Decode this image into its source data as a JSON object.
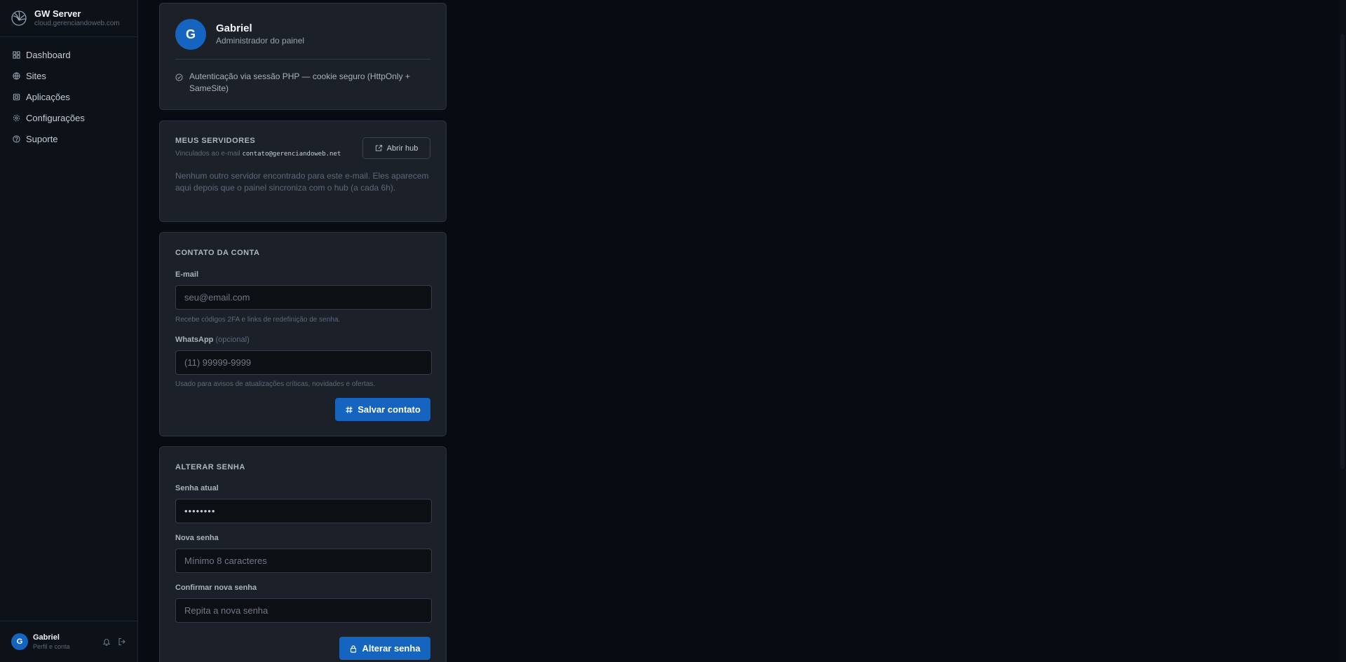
{
  "brand": {
    "name": "GW Server",
    "domain": "cloud.gerenciandoweb.com"
  },
  "nav": [
    {
      "label": "Dashboard",
      "icon": "grid-icon"
    },
    {
      "label": "Sites",
      "icon": "globe-icon"
    },
    {
      "label": "Aplicações",
      "icon": "box-icon"
    },
    {
      "label": "Configurações",
      "icon": "gear-icon"
    },
    {
      "label": "Suporte",
      "icon": "help-circle-icon"
    }
  ],
  "user": {
    "initial": "G",
    "name": "Gabriel",
    "subtitle": "Perfil e conta"
  },
  "profile": {
    "initial": "G",
    "name": "Gabriel",
    "role": "Administrador do painel",
    "auth_note": "Autenticação via sessão PHP — cookie seguro (HttpOnly + SameSite)"
  },
  "servers": {
    "title": "MEUS SERVIDORES",
    "subtitle_prefix": "Vinculados ao e-mail",
    "email": "contato@gerenciandoweb.net",
    "hub_button": "Abrir hub",
    "empty_text": "Nenhum outro servidor encontrado para este e-mail. Eles aparecem aqui depois que o painel sincroniza com o hub (a cada 6h)."
  },
  "contact": {
    "title": "CONTATO DA CONTA",
    "email_label": "E-mail",
    "email_placeholder": "seu@email.com",
    "email_hint": "Recebe códigos 2FA e links de redefinição de senha.",
    "whatsapp_label": "WhatsApp",
    "whatsapp_optional": "(opcional)",
    "whatsapp_placeholder": "(11) 99999-9999",
    "whatsapp_hint": "Usado para avisos de atualizações críticas, novidades e ofertas.",
    "save_button": "Salvar contato"
  },
  "password": {
    "title": "ALTERAR SENHA",
    "current_label": "Senha atual",
    "current_value": "••••••••",
    "new_label": "Nova senha",
    "new_placeholder": "Mínimo 8 caracteres",
    "confirm_label": "Confirmar nova senha",
    "confirm_placeholder": "Repita a nova senha",
    "submit_button": "Alterar senha"
  },
  "colors": {
    "accent": "#1565c0",
    "background": "#080b12",
    "card": "#1b2029"
  }
}
